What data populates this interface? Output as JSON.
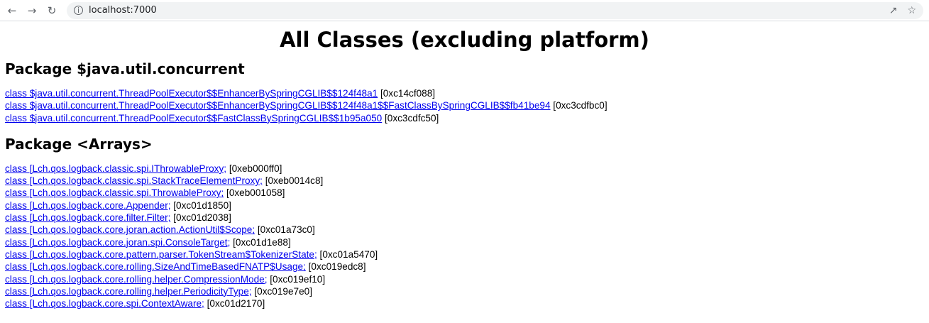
{
  "browser": {
    "url": "localhost:7000"
  },
  "title": "All Classes (excluding platform)",
  "packages": [
    {
      "heading": "Package $java.util.concurrent",
      "classes": [
        {
          "name": "class $java.util.concurrent.ThreadPoolExecutor$$EnhancerBySpringCGLIB$$124f48a1",
          "addr": "[0xc14cf088]"
        },
        {
          "name": "class $java.util.concurrent.ThreadPoolExecutor$$EnhancerBySpringCGLIB$$124f48a1$$FastClassBySpringCGLIB$$fb41be94",
          "addr": "[0xc3cdfbc0]"
        },
        {
          "name": "class $java.util.concurrent.ThreadPoolExecutor$$FastClassBySpringCGLIB$$1b95a050",
          "addr": "[0xc3cdfc50]"
        }
      ]
    },
    {
      "heading": "Package <Arrays>",
      "classes": [
        {
          "name": "class [Lch.qos.logback.classic.spi.IThrowableProxy;",
          "addr": "[0xeb000ff0]"
        },
        {
          "name": "class [Lch.qos.logback.classic.spi.StackTraceElementProxy;",
          "addr": "[0xeb0014c8]"
        },
        {
          "name": "class [Lch.qos.logback.classic.spi.ThrowableProxy;",
          "addr": "[0xeb001058]"
        },
        {
          "name": "class [Lch.qos.logback.core.Appender;",
          "addr": "[0xc01d1850]"
        },
        {
          "name": "class [Lch.qos.logback.core.filter.Filter;",
          "addr": "[0xc01d2038]"
        },
        {
          "name": "class [Lch.qos.logback.core.joran.action.ActionUtil$Scope;",
          "addr": "[0xc01a73c0]"
        },
        {
          "name": "class [Lch.qos.logback.core.joran.spi.ConsoleTarget;",
          "addr": "[0xc01d1e88]"
        },
        {
          "name": "class [Lch.qos.logback.core.pattern.parser.TokenStream$TokenizerState;",
          "addr": "[0xc01a5470]"
        },
        {
          "name": "class [Lch.qos.logback.core.rolling.SizeAndTimeBasedFNATP$Usage;",
          "addr": "[0xc019edc8]"
        },
        {
          "name": "class [Lch.qos.logback.core.rolling.helper.CompressionMode;",
          "addr": "[0xc019ef10]"
        },
        {
          "name": "class [Lch.qos.logback.core.rolling.helper.PeriodicityType;",
          "addr": "[0xc019e7e0]"
        },
        {
          "name": "class [Lch.qos.logback.core.spi.ContextAware;",
          "addr": "[0xc01d2170]"
        }
      ]
    }
  ]
}
